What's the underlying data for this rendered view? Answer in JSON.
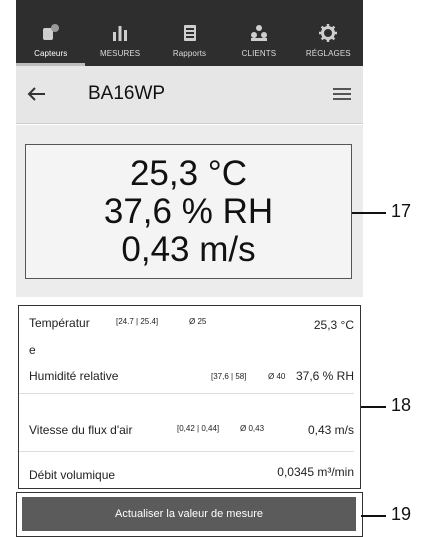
{
  "nav": {
    "tabs": [
      {
        "label": "Capteurs",
        "icon": "sensor-icon",
        "active": true
      },
      {
        "label": "MESURES",
        "icon": "bar-chart-icon",
        "active": false
      },
      {
        "label": "Rapports",
        "icon": "report-icon",
        "active": false
      },
      {
        "label": "CLIENTS",
        "icon": "clients-icon",
        "active": false
      },
      {
        "label": "RÉGLAGES",
        "icon": "gear-icon",
        "active": false
      }
    ]
  },
  "header": {
    "back_icon": "back-arrow-icon",
    "title": "BA16WP",
    "menu_icon": "hamburger-menu-icon"
  },
  "display": {
    "temperature": "25,3 °C",
    "humidity": "37,6 % RH",
    "airflow": "0,43 m/s"
  },
  "details": {
    "rows": [
      {
        "label": "Températur",
        "label_wrap": "e",
        "range": "[24.7 | 25.4]",
        "avg": "Ø 25",
        "value": "25,3 °C"
      },
      {
        "label": "Humidité relative",
        "range": "[37,6 | 58]",
        "avg": "Ø 40",
        "value": "37,6 % RH"
      },
      {
        "label": "Vitesse du flux d'air",
        "range": "[0,42 | 0,44]",
        "avg": "Ø 0,43",
        "value": "0,43 m/s"
      },
      {
        "label": "Débit volumique",
        "value": "0,0345 m³/min"
      }
    ]
  },
  "actions": {
    "update_label": "Actualiser la valeur de mesure"
  },
  "callouts": {
    "display_ref": "17",
    "details_ref": "18",
    "button_ref": "19"
  },
  "colors": {
    "topbar": "#2e2e2e",
    "subbar": "#e6e6e6",
    "button": "#5b5b5b"
  }
}
